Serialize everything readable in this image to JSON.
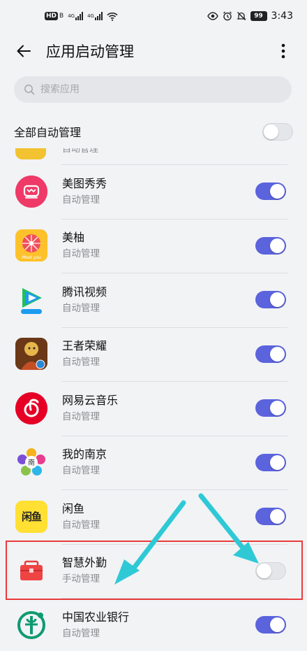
{
  "status_bar": {
    "left_badge": "HD",
    "left_badge_sub": "B",
    "net1": "4G",
    "net2": "4G",
    "battery": "99",
    "time": "3:43"
  },
  "header": {
    "title": "应用启动管理",
    "back_icon": "arrow-left-icon",
    "more_icon": "more-vertical-icon"
  },
  "search": {
    "placeholder": "搜索应用",
    "value": ""
  },
  "all_auto": {
    "label": "全部自动管理",
    "enabled": false
  },
  "partial_row": {
    "sub": "自动管理"
  },
  "apps": [
    {
      "name": "美图秀秀",
      "mode": "自动管理",
      "enabled": true,
      "icon": "meitu-icon"
    },
    {
      "name": "美柚",
      "mode": "自动管理",
      "enabled": true,
      "icon": "meiyou-icon"
    },
    {
      "name": "腾讯视频",
      "mode": "自动管理",
      "enabled": true,
      "icon": "tencent-video-icon"
    },
    {
      "name": "王者荣耀",
      "mode": "自动管理",
      "enabled": true,
      "icon": "honor-of-kings-icon"
    },
    {
      "name": "网易云音乐",
      "mode": "自动管理",
      "enabled": true,
      "icon": "netease-music-icon"
    },
    {
      "name": "我的南京",
      "mode": "自动管理",
      "enabled": true,
      "icon": "my-nanjing-icon"
    },
    {
      "name": "闲鱼",
      "mode": "自动管理",
      "enabled": true,
      "icon": "xianyu-icon",
      "icon_text": "闲鱼"
    },
    {
      "name": "智慧外勤",
      "mode": "手动管理",
      "enabled": false,
      "icon": "smart-field-icon"
    },
    {
      "name": "中国农业银行",
      "mode": "自动管理",
      "enabled": true,
      "icon": "abc-bank-icon"
    }
  ],
  "colors": {
    "toggle_on": "#5b63dd",
    "toggle_off": "#e4e6e9",
    "highlight": "#ea3b3b",
    "arrow": "#2fc9d6"
  }
}
